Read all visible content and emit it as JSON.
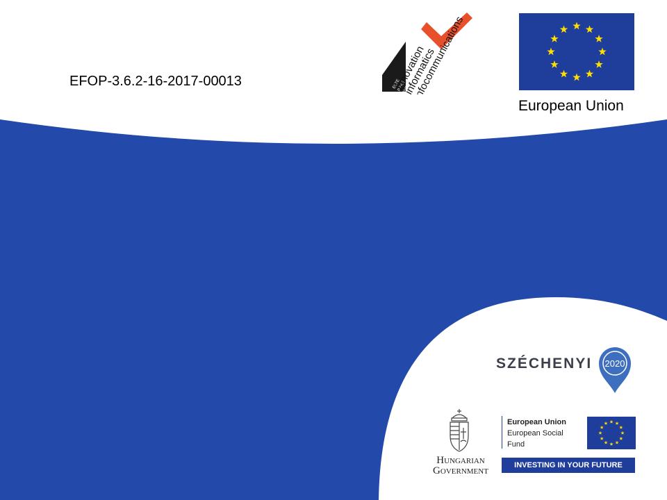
{
  "header": {
    "project_code": "EFOP-3.6.2-16-2017-00013",
    "eu_caption": "European Union"
  },
  "iik_logo": {
    "lines": [
      "innovation",
      "informatics",
      "infocommunications"
    ],
    "side_text": [
      "ELTE",
      "PPKE",
      "BME"
    ]
  },
  "szechenyi": {
    "word": "SZÉCHENYI",
    "year": "2020"
  },
  "government": {
    "line1": "Hungarian",
    "line2": "Government"
  },
  "esf": {
    "title": "European Union",
    "line1": "European Social",
    "line2": "Fund",
    "banner": "INVESTING IN YOUR FUTURE"
  },
  "colors": {
    "brand_blue": "#234AAA",
    "eu_blue": "#1F3E9C",
    "eu_star": "#FFDD00",
    "iik_orange": "#E8502B",
    "pin_blue": "#3E6FBF"
  }
}
